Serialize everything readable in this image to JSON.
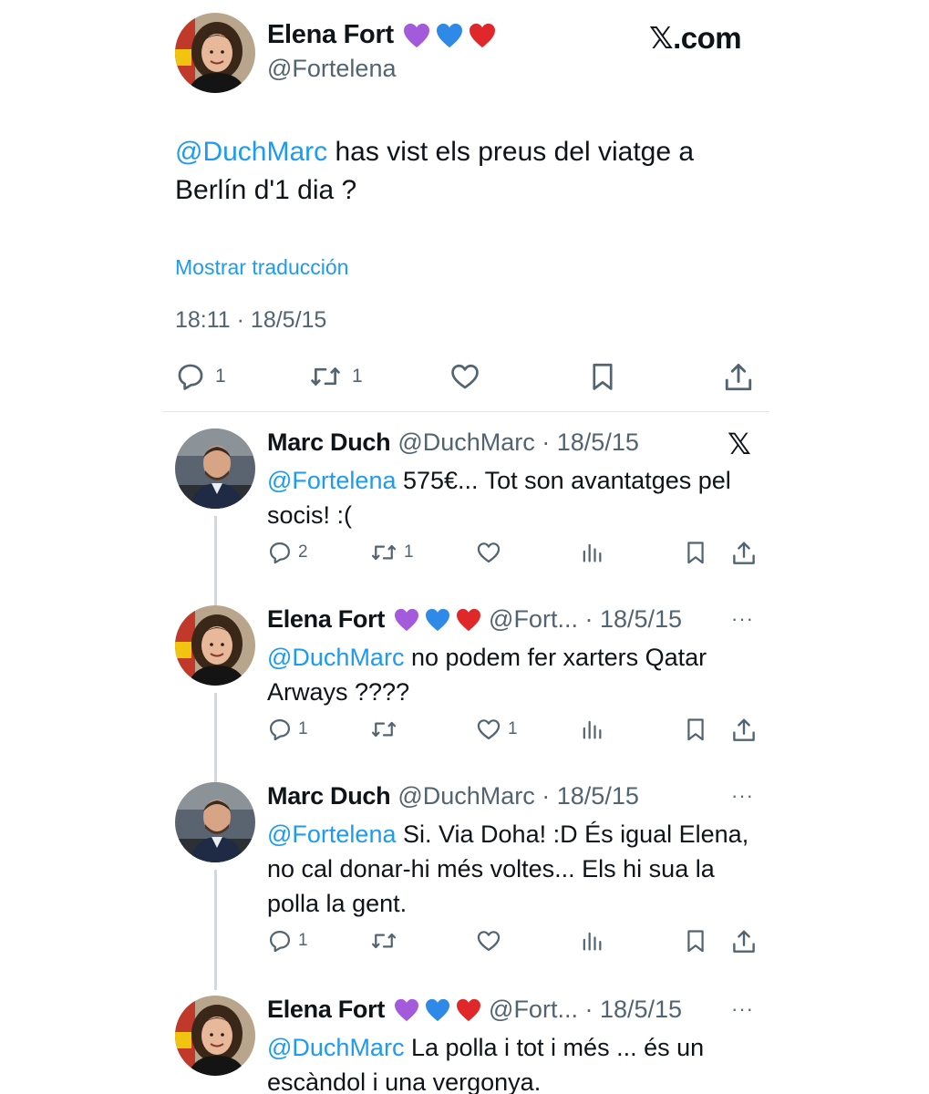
{
  "main_tweet": {
    "author_name": "Elena Fort",
    "emojis": [
      "purple-heart",
      "blue-heart",
      "red-heart"
    ],
    "handle": "@Fortelena",
    "brand": "𝕏.com",
    "mention": "@DuchMarc",
    "text": " has vist els preus del viatge a Berlín d'1 dia ?",
    "translate_label": "Mostrar traducción",
    "timestamp": "18:11 · 18/5/15",
    "replies": "1",
    "retweets": "1",
    "likes": "",
    "colors": {
      "accent": "#1d9bf0",
      "muted": "#536471",
      "text": "#0f1419"
    }
  },
  "replies": [
    {
      "author_name": "Marc Duch",
      "handle": "@DuchMarc · 18/5/15",
      "mention": "@Fortelena",
      "text": " 575€... Tot son avantatges pel socis! :(",
      "replies": "2",
      "retweets": "1",
      "likes": "",
      "corner": "𝕏"
    },
    {
      "author_name": "Elena Fort",
      "emojis": [
        "purple-heart",
        "blue-heart",
        "red-heart"
      ],
      "handle": "@Fort... · 18/5/15",
      "mention": "@DuchMarc",
      "text": " no podem fer xarters Qatar Arways ????",
      "replies": "1",
      "retweets": "",
      "likes": "1",
      "corner": "···"
    },
    {
      "author_name": "Marc Duch",
      "handle": "@DuchMarc · 18/5/15",
      "mention": "@Fortelena",
      "text": " Si. Via Doha! :D És igual Elena, no cal donar-hi més voltes... Els hi sua la polla la gent.",
      "replies": "1",
      "retweets": "",
      "likes": "",
      "corner": "···"
    },
    {
      "author_name": "Elena Fort",
      "emojis": [
        "purple-heart",
        "blue-heart",
        "red-heart"
      ],
      "handle": "@Fort... · 18/5/15",
      "mention": "@DuchMarc",
      "text": " La polla i tot i més ... és un escàndol i una vergonya.",
      "corner": "···"
    }
  ]
}
